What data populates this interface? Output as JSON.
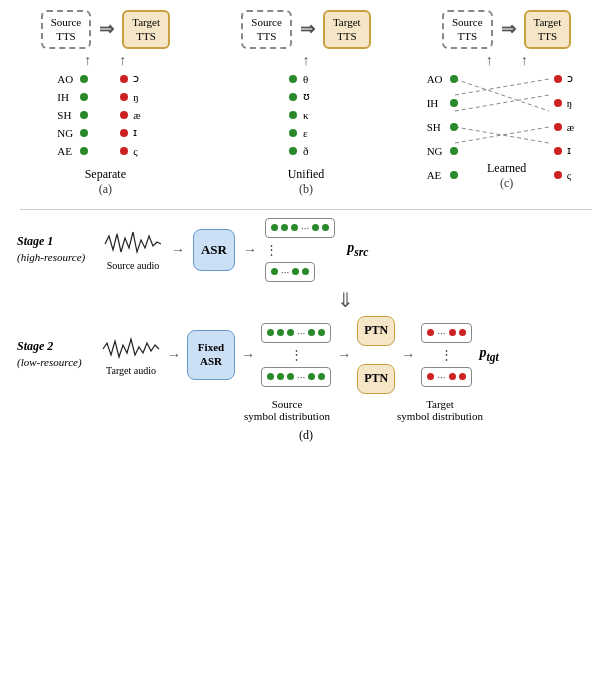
{
  "diagrams": {
    "separate": {
      "label": "Separate",
      "sublabel": "(a)",
      "source_label": "Source\nTTS",
      "target_label": "Target\nTTS",
      "left_phonemes": [
        "AO",
        "IH",
        "SH",
        "NG",
        "AE"
      ],
      "right_phonemes": [
        "ɔ",
        "ŋ",
        "æ",
        "ɪ",
        "ς"
      ],
      "left_dot_color": "green",
      "right_dot_color": "red"
    },
    "unified": {
      "label": "Unified",
      "sublabel": "(b)",
      "source_label": "Source\nTTS",
      "target_label": "Target\nTTS",
      "phonemes": [
        "θ",
        "ʊ",
        "κ",
        "ε",
        "ð"
      ]
    },
    "learned": {
      "label": "Learned",
      "sublabel": "(c)",
      "source_label": "Source\nTTS",
      "target_label": "Target\nTTS",
      "left_phonemes": [
        "AO",
        "IH",
        "SH",
        "NG",
        "AE"
      ],
      "right_phonemes": [
        "ɔ",
        "ŋ",
        "æ",
        "ɪ",
        "ς"
      ]
    }
  },
  "stage1": {
    "label": "Stage 1",
    "sublabel": "(high-resource)",
    "audio_label": "Source audio",
    "asr_label": "ASR",
    "p_label": "p",
    "p_sub": "src"
  },
  "stage2": {
    "label": "Stage 2",
    "sublabel": "(low-resource)",
    "audio_label": "Target audio",
    "asr_label": "Fixed\nASR",
    "p_label": "p",
    "p_sub": "tgt",
    "ptn_label": "PTN",
    "source_sym_label": "Source",
    "source_sym_sub": "symbol distribution",
    "target_sym_label": "Target",
    "target_sym_sub": "symbol distribution"
  },
  "bottom_label": "(d)"
}
